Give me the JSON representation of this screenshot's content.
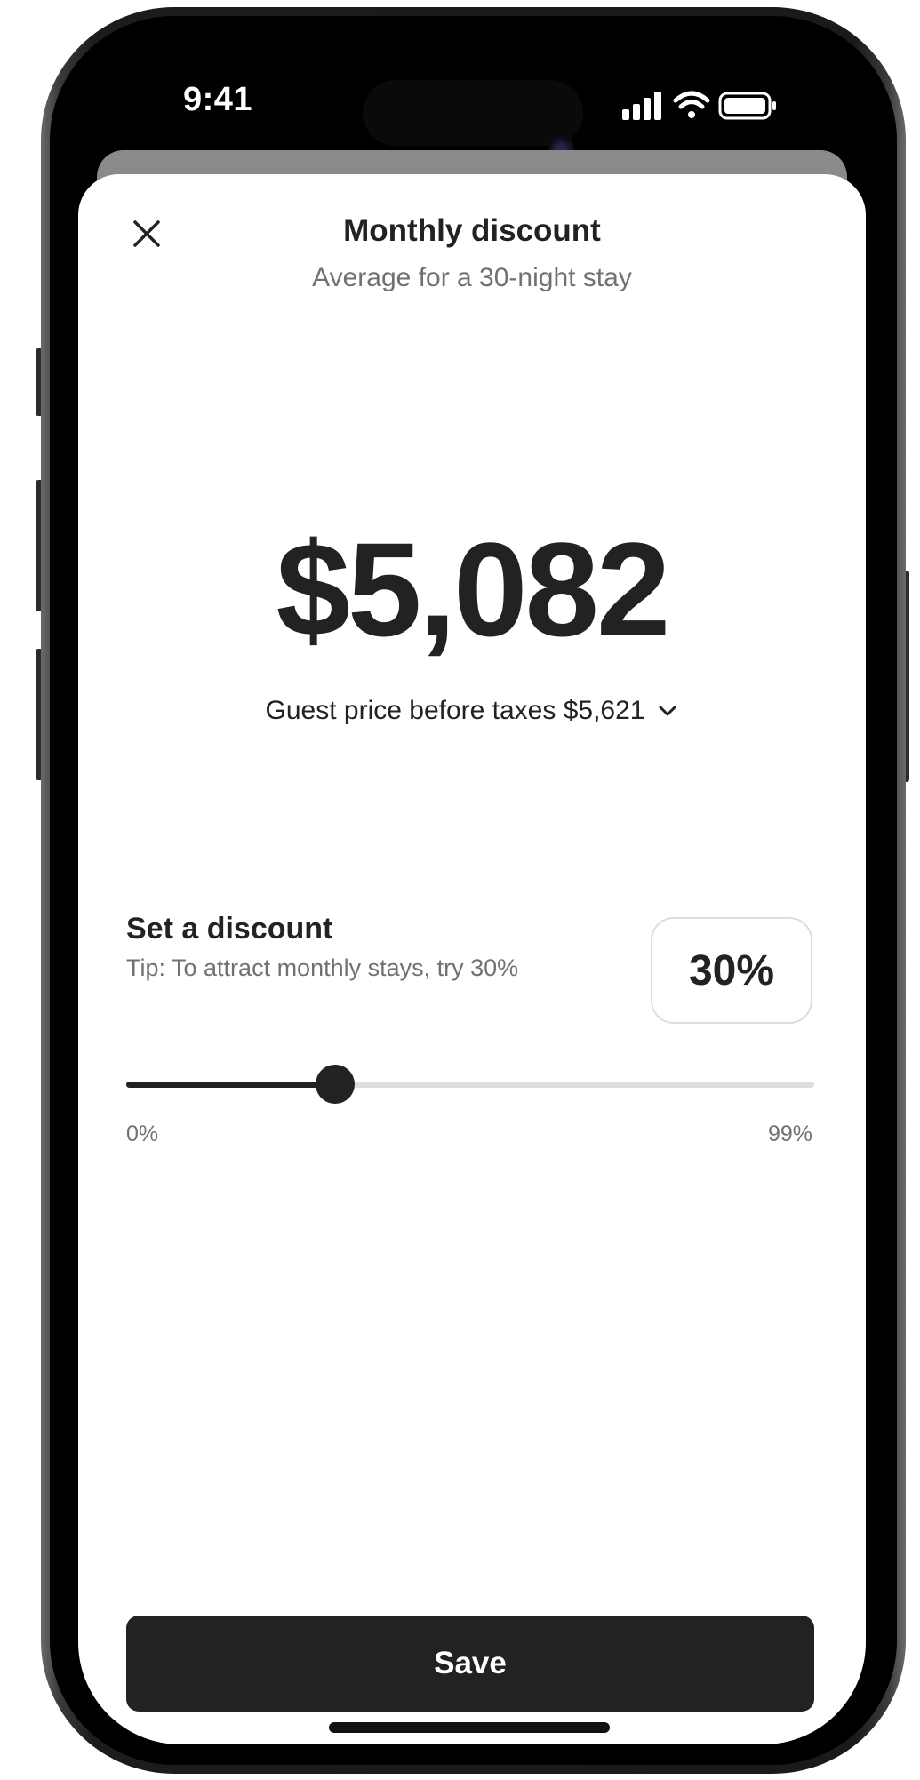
{
  "status_bar": {
    "time": "9:41",
    "icons": [
      "signal-icon",
      "wifi-icon",
      "battery-icon"
    ]
  },
  "sheet": {
    "close_icon": "close-icon",
    "title": "Monthly discount",
    "subtitle": "Average for a 30-night stay",
    "price": "$5,082",
    "guest_price_label": "Guest price before taxes $5,621",
    "guest_price_icon": "chevron-down-icon"
  },
  "discount": {
    "label": "Set a discount",
    "tip": "Tip: To attract monthly stays, try 30%",
    "value_text": "30%",
    "slider": {
      "value": 30,
      "min": 0,
      "max": 99,
      "min_label": "0%",
      "max_label": "99%"
    }
  },
  "footer": {
    "save_label": "Save"
  },
  "colors": {
    "primary": "#222222",
    "secondary_text": "#717171",
    "track": "#dddddd",
    "background": "#ffffff"
  }
}
